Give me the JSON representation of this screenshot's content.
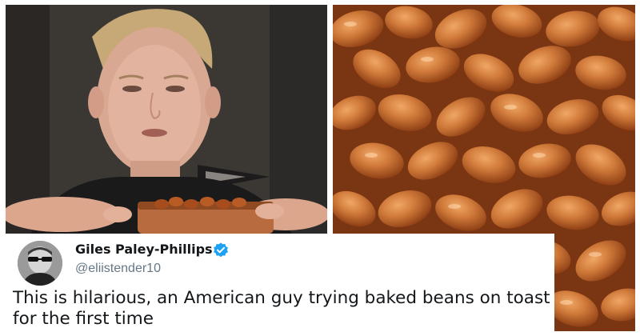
{
  "tweet": {
    "display_name": "Giles Paley-Phillips",
    "handle": "@eliistender10",
    "text": "This is hilarious, an American guy trying baked beans on toast for the first time",
    "verified": true
  },
  "photos": {
    "left": {
      "subject": "man holding baked beans on toast"
    },
    "right": {
      "subject": "close-up of baked beans"
    }
  },
  "colors": {
    "verified_badge": "#1da1f2",
    "name_text": "#14171a",
    "handle_text": "#657786",
    "background": "#ffffff"
  },
  "icons": [
    "verified-badge-icon"
  ]
}
